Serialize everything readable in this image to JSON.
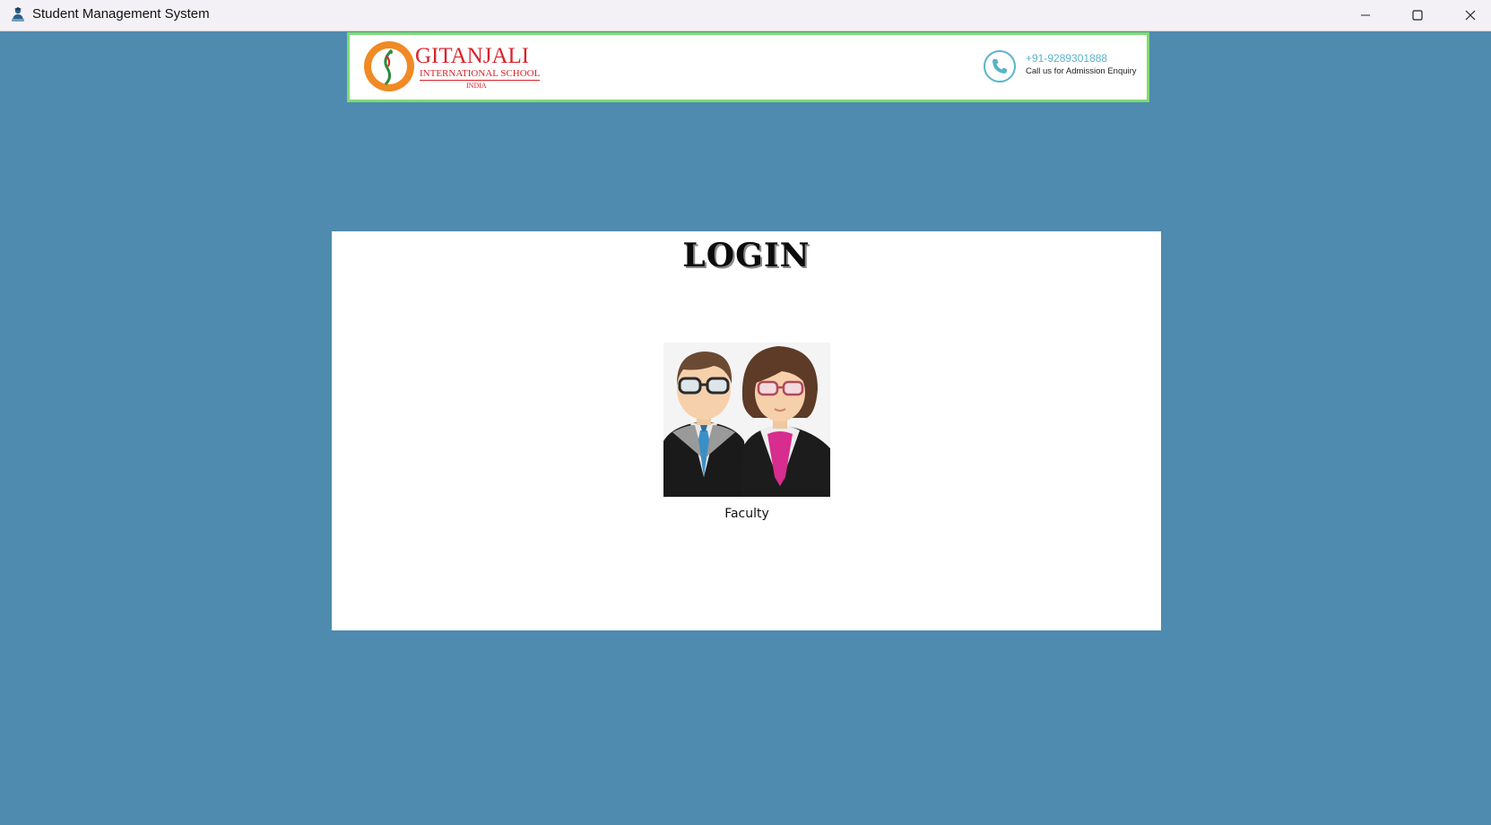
{
  "window": {
    "title": "Student Management System"
  },
  "banner": {
    "school_name": "GITANJALI",
    "school_subtitle": "INTERNATIONAL SCHOOL",
    "school_country": "INDIA",
    "phone_number": "+91-9289301888",
    "phone_caption": "Call us for Admission Enquiry"
  },
  "login": {
    "heading": "LOGIN",
    "faculty_label": "Faculty"
  },
  "colors": {
    "background": "#4f8aaf",
    "banner_border": "#7fdc6f",
    "brand_red": "#d9232a",
    "brand_orange": "#f08a24",
    "phone_teal": "#5ab3c9"
  },
  "icons": [
    "app-icon",
    "minimize-icon",
    "maximize-icon",
    "close-icon",
    "school-emblem-icon",
    "phone-icon",
    "faculty-avatar-icon"
  ]
}
